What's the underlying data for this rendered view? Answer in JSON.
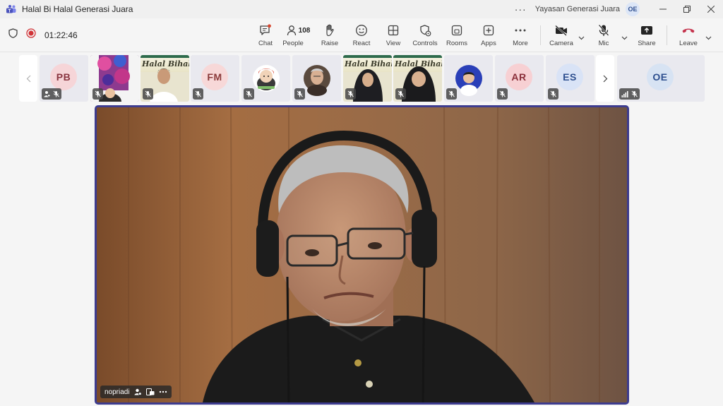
{
  "window": {
    "title": "Halal Bi Halal Generasi Juara",
    "organization": "Yayasan Generasi Juara",
    "user_initials": "OE"
  },
  "meeting": {
    "elapsed": "01:22:46"
  },
  "toolbar": {
    "chat": "Chat",
    "people": "People",
    "people_count": "108",
    "raise": "Raise",
    "react": "React",
    "view": "View",
    "controls": "Controls",
    "rooms": "Rooms",
    "apps": "Apps",
    "more": "More",
    "camera": "Camera",
    "mic": "Mic",
    "share": "Share",
    "leave": "Leave"
  },
  "participants": [
    {
      "type": "avatar",
      "initials": "PB",
      "bg": "#f6d5d8",
      "fg": "#8a3540"
    },
    {
      "type": "video",
      "banner": ""
    },
    {
      "type": "video",
      "banner": "Halal Bihalal"
    },
    {
      "type": "avatar",
      "initials": "FM",
      "bg": "#f7d8d8",
      "fg": "#8a3a3a"
    },
    {
      "type": "image"
    },
    {
      "type": "image"
    },
    {
      "type": "video",
      "banner": "Halal Bihalal"
    },
    {
      "type": "video",
      "banner": "Halal Bihalal"
    },
    {
      "type": "image"
    },
    {
      "type": "avatar",
      "initials": "AR",
      "bg": "#f7d0d3",
      "fg": "#8a2f3a"
    },
    {
      "type": "avatar",
      "initials": "ES",
      "bg": "#d9e3f6",
      "fg": "#2e4f8f"
    },
    {
      "type": "avatar",
      "initials": "OE",
      "bg": "#d7e3f3",
      "fg": "#2e4f8f"
    }
  ],
  "main_video": {
    "name": "nopriadi"
  },
  "colors": {
    "accent": "#3d3c8f",
    "leave": "#c4314b",
    "record": "#d13438"
  }
}
